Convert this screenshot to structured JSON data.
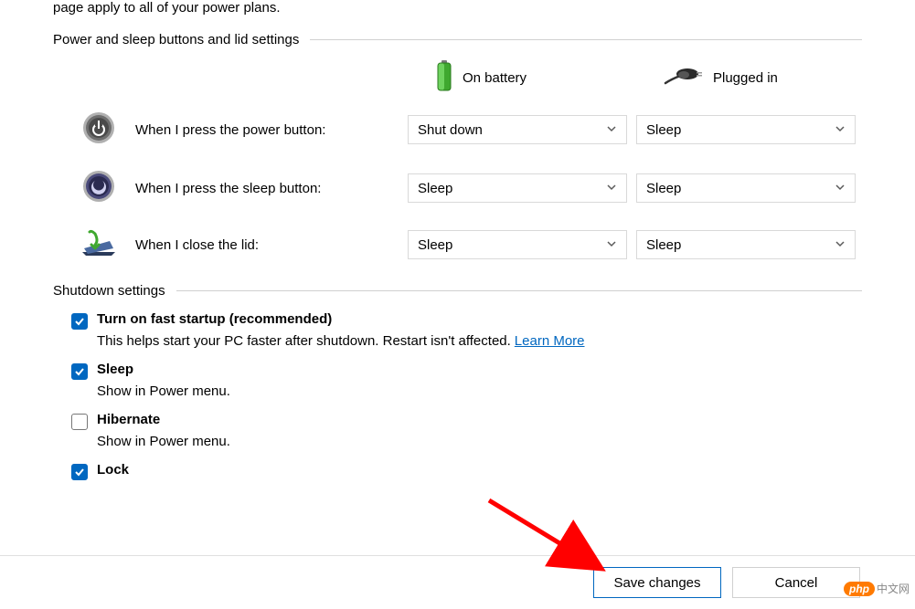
{
  "intro": "page apply to all of your power plans.",
  "sections": {
    "buttons_lid": {
      "title": "Power and sleep buttons and lid settings",
      "columns": {
        "battery": "On battery",
        "plugged": "Plugged in"
      },
      "rows": {
        "power": {
          "label": "When I press the power button:",
          "battery": "Shut down",
          "plugged": "Sleep"
        },
        "sleep": {
          "label": "When I press the sleep button:",
          "battery": "Sleep",
          "plugged": "Sleep"
        },
        "lid": {
          "label": "When I close the lid:",
          "battery": "Sleep",
          "plugged": "Sleep"
        }
      }
    },
    "shutdown": {
      "title": "Shutdown settings",
      "items": {
        "fast_startup": {
          "checked": true,
          "label": "Turn on fast startup (recommended)",
          "desc": "This helps start your PC faster after shutdown. Restart isn't affected.",
          "link": "Learn More"
        },
        "sleep": {
          "checked": true,
          "label": "Sleep",
          "desc": "Show in Power menu."
        },
        "hibernate": {
          "checked": false,
          "label": "Hibernate",
          "desc": "Show in Power menu."
        },
        "lock": {
          "checked": true,
          "label": "Lock"
        }
      }
    }
  },
  "footer": {
    "save": "Save changes",
    "cancel": "Cancel"
  },
  "watermark": {
    "badge": "php",
    "text": "中文网"
  }
}
